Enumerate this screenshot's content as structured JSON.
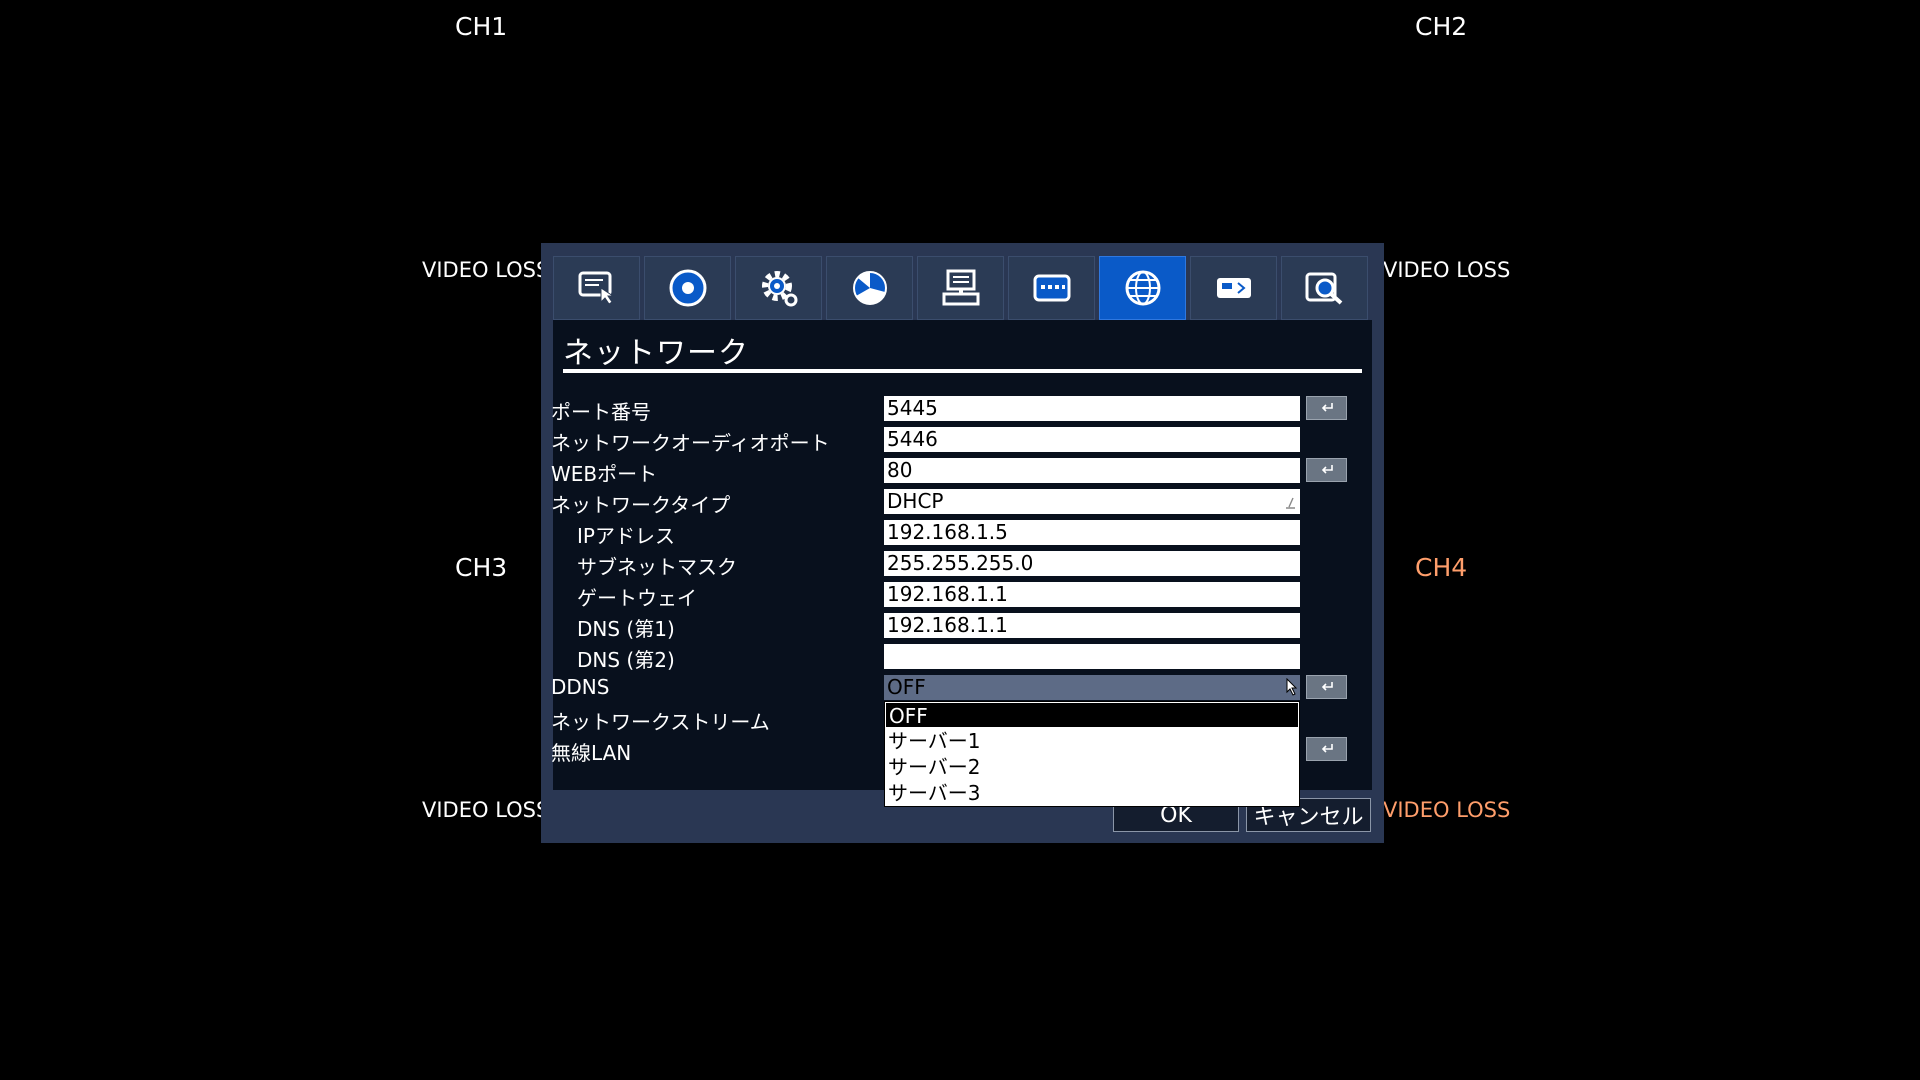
{
  "channels": {
    "ch1": "CH1",
    "ch2": "CH2",
    "ch3": "CH3",
    "ch4": "CH4",
    "video_loss": "VIDEO LOSS"
  },
  "tabs": [
    {
      "name": "display",
      "icon": "monitor-touch-icon"
    },
    {
      "name": "record",
      "icon": "record-icon"
    },
    {
      "name": "system",
      "icon": "gear-icon"
    },
    {
      "name": "event",
      "icon": "pie-chart-icon"
    },
    {
      "name": "device",
      "icon": "computer-icon"
    },
    {
      "name": "input",
      "icon": "keyboard-icon"
    },
    {
      "name": "network",
      "icon": "globe-icon",
      "active": true
    },
    {
      "name": "storage",
      "icon": "hdd-icon"
    },
    {
      "name": "search",
      "icon": "search-icon"
    }
  ],
  "network": {
    "title": "ネットワーク",
    "port_label": "ポート番号",
    "port_value": "5445",
    "audio_port_label": "ネットワークオーディオポート",
    "audio_port_value": "5446",
    "web_port_label": "WEBポート",
    "web_port_value": "80",
    "type_label": "ネットワークタイプ",
    "type_value": "DHCP",
    "ip_label": "IPアドレス",
    "ip_value": "192.168.1.5",
    "subnet_label": "サブネットマスク",
    "subnet_value": "255.255.255.0",
    "gateway_label": "ゲートウェイ",
    "gateway_value": "192.168.1.1",
    "dns1_label": "DNS (第1)",
    "dns1_value": "192.168.1.1",
    "dns2_label": "DNS (第2)",
    "dns2_value": "",
    "ddns_label": "DDNS",
    "ddns_value": "OFF",
    "stream_label": "ネットワークストリーム",
    "wlan_label": "無線LAN"
  },
  "ddns_options": [
    "OFF",
    "サーバー1",
    "サーバー2",
    "サーバー3"
  ],
  "footer": {
    "ok": "OK",
    "cancel": "キャンセル"
  },
  "colors": {
    "active_tab": "#0a5ac8",
    "dialog_bg": "#2a3753",
    "content_bg": "#08101d",
    "ch4_accent": "#ff9e6b"
  }
}
